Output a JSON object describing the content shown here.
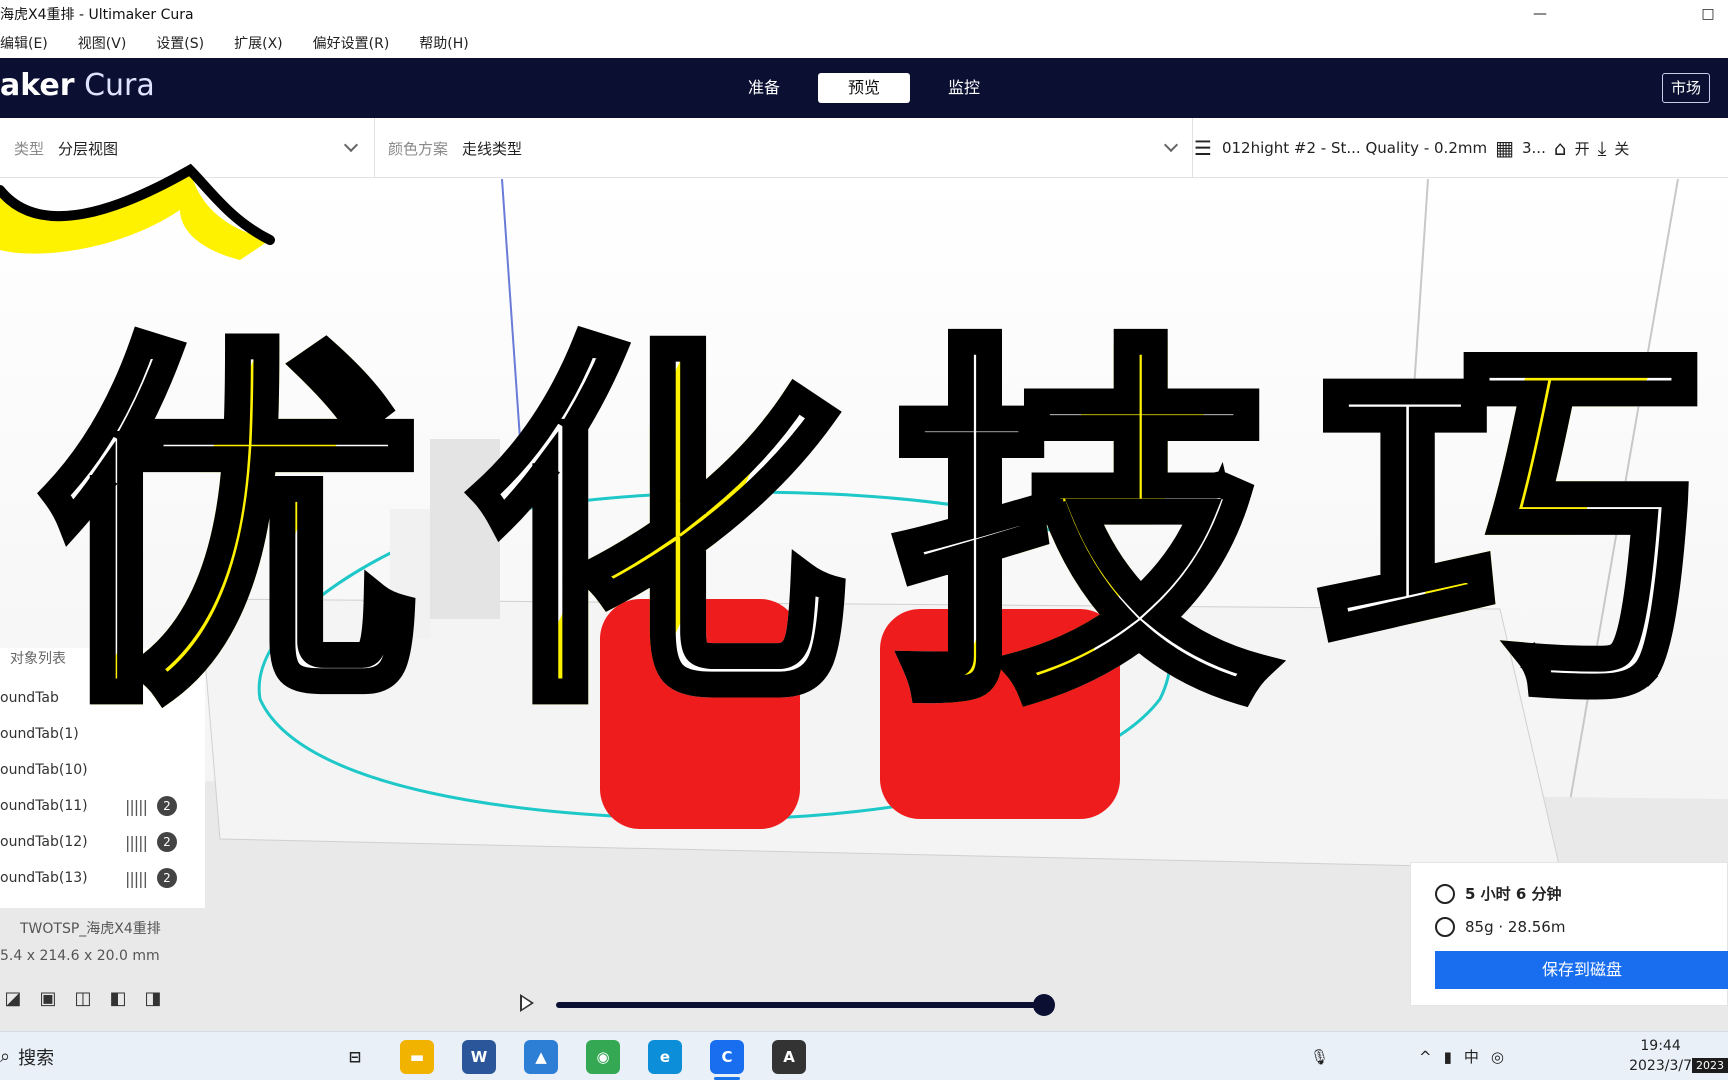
{
  "window": {
    "title": "海虎X4重排 - Ultimaker Cura",
    "minimize": "—",
    "maximize": "□"
  },
  "menu": [
    "编辑(E)",
    "视图(V)",
    "设置(S)",
    "扩展(X)",
    "偏好设置(R)",
    "帮助(H)"
  ],
  "header": {
    "brand_bold": "aker",
    "brand_light": "Cura",
    "stages": [
      "准备",
      "预览",
      "监控"
    ],
    "active_stage": "预览",
    "market": "市场"
  },
  "toolbar": {
    "view_type_label": "类型",
    "view_type_value": "分层视图",
    "color_scheme_label": "颜色方案",
    "color_scheme_value": "走线类型",
    "profile": "012hight #2 - St... Quality - 0.2mm",
    "infill": "3...",
    "support": "开",
    "adhesion": "关"
  },
  "objects": {
    "header": "对象列表",
    "items": [
      {
        "name": "oundTab",
        "count": ""
      },
      {
        "name": "oundTab(1)",
        "count": ""
      },
      {
        "name": "oundTab(10)",
        "count": ""
      },
      {
        "name": "oundTab(11)",
        "count": "2"
      },
      {
        "name": "oundTab(12)",
        "count": "2"
      },
      {
        "name": "oundTab(13)",
        "count": "2"
      }
    ],
    "project_name": "TWOTSP_海虎X4重排",
    "dimensions": "5.4 x 214.6 x 20.0 mm"
  },
  "print": {
    "time": "5 小时 6 分钟",
    "material": "85g · 28.56m",
    "save_button": "保存到磁盘"
  },
  "layer_slider": {
    "progress": 1.0
  },
  "overlay": {
    "chars": [
      "优",
      "化",
      "技",
      "巧"
    ]
  },
  "taskbar": {
    "search": "搜索",
    "apps": [
      {
        "icon": "task-view-icon",
        "label": "⊟",
        "color": "#e9f0f8"
      },
      {
        "icon": "file-explorer-icon",
        "label": "▬",
        "color": "#f2b300"
      },
      {
        "icon": "word-icon",
        "label": "W",
        "color": "#2b579a"
      },
      {
        "icon": "photos-icon",
        "label": "▲",
        "color": "#2d7fd6"
      },
      {
        "icon": "chrome-icon",
        "label": "◉",
        "color": "#34a853"
      },
      {
        "icon": "edge-icon",
        "label": "e",
        "color": "#0c8fd8"
      },
      {
        "icon": "cura-icon",
        "label": "C",
        "color": "#196ef0"
      },
      {
        "icon": "app-icon",
        "label": "A",
        "color": "#333333"
      }
    ],
    "time": "19:44",
    "date": "2023/3/7",
    "date_badge": "2023"
  },
  "colors": {
    "header_bg": "#0b1033",
    "accent": "#196ef0",
    "highlight": "#fff200"
  }
}
